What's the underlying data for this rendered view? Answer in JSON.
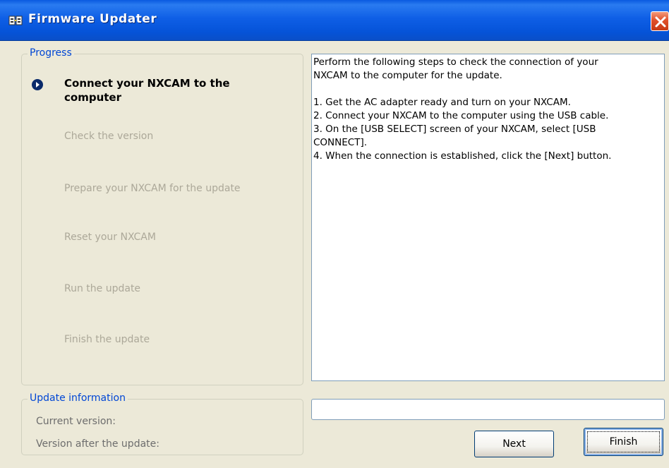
{
  "window": {
    "title": "Firmware Updater"
  },
  "progress": {
    "legend": "Progress",
    "steps": [
      {
        "label": "Connect your NXCAM to the computer",
        "state": "active"
      },
      {
        "label": "Check the version",
        "state": "inactive"
      },
      {
        "label": "Prepare your NXCAM for the update",
        "state": "inactive"
      },
      {
        "label": "Reset your NXCAM",
        "state": "inactive"
      },
      {
        "label": "Run the update",
        "state": "inactive"
      },
      {
        "label": "Finish the update",
        "state": "inactive"
      }
    ]
  },
  "update_info": {
    "legend": "Update information",
    "current_version_label": "Current version:",
    "version_after_label": "Version after the update:"
  },
  "instructions": {
    "text": "Perform the following steps to check the connection of your\nNXCAM to the computer for the update.\n\n1. Get the AC adapter ready and turn on your NXCAM.\n2. Connect your NXCAM to the computer using the USB cable.\n3. On the [USB SELECT] screen of your NXCAM, select [USB\nCONNECT].\n4. When the connection is established, click the [Next] button."
  },
  "buttons": {
    "next_label": "Next",
    "finish_label": "Finish"
  },
  "icons": {
    "app": "firmware-updater-app-icon",
    "close": "close-icon",
    "step_indicator": "arrow-right-circle-icon"
  },
  "colors": {
    "titlebar": "#0553d8",
    "legend_text": "#0046d5",
    "inactive_step": "#aca899",
    "close_button": "#e0502a"
  }
}
